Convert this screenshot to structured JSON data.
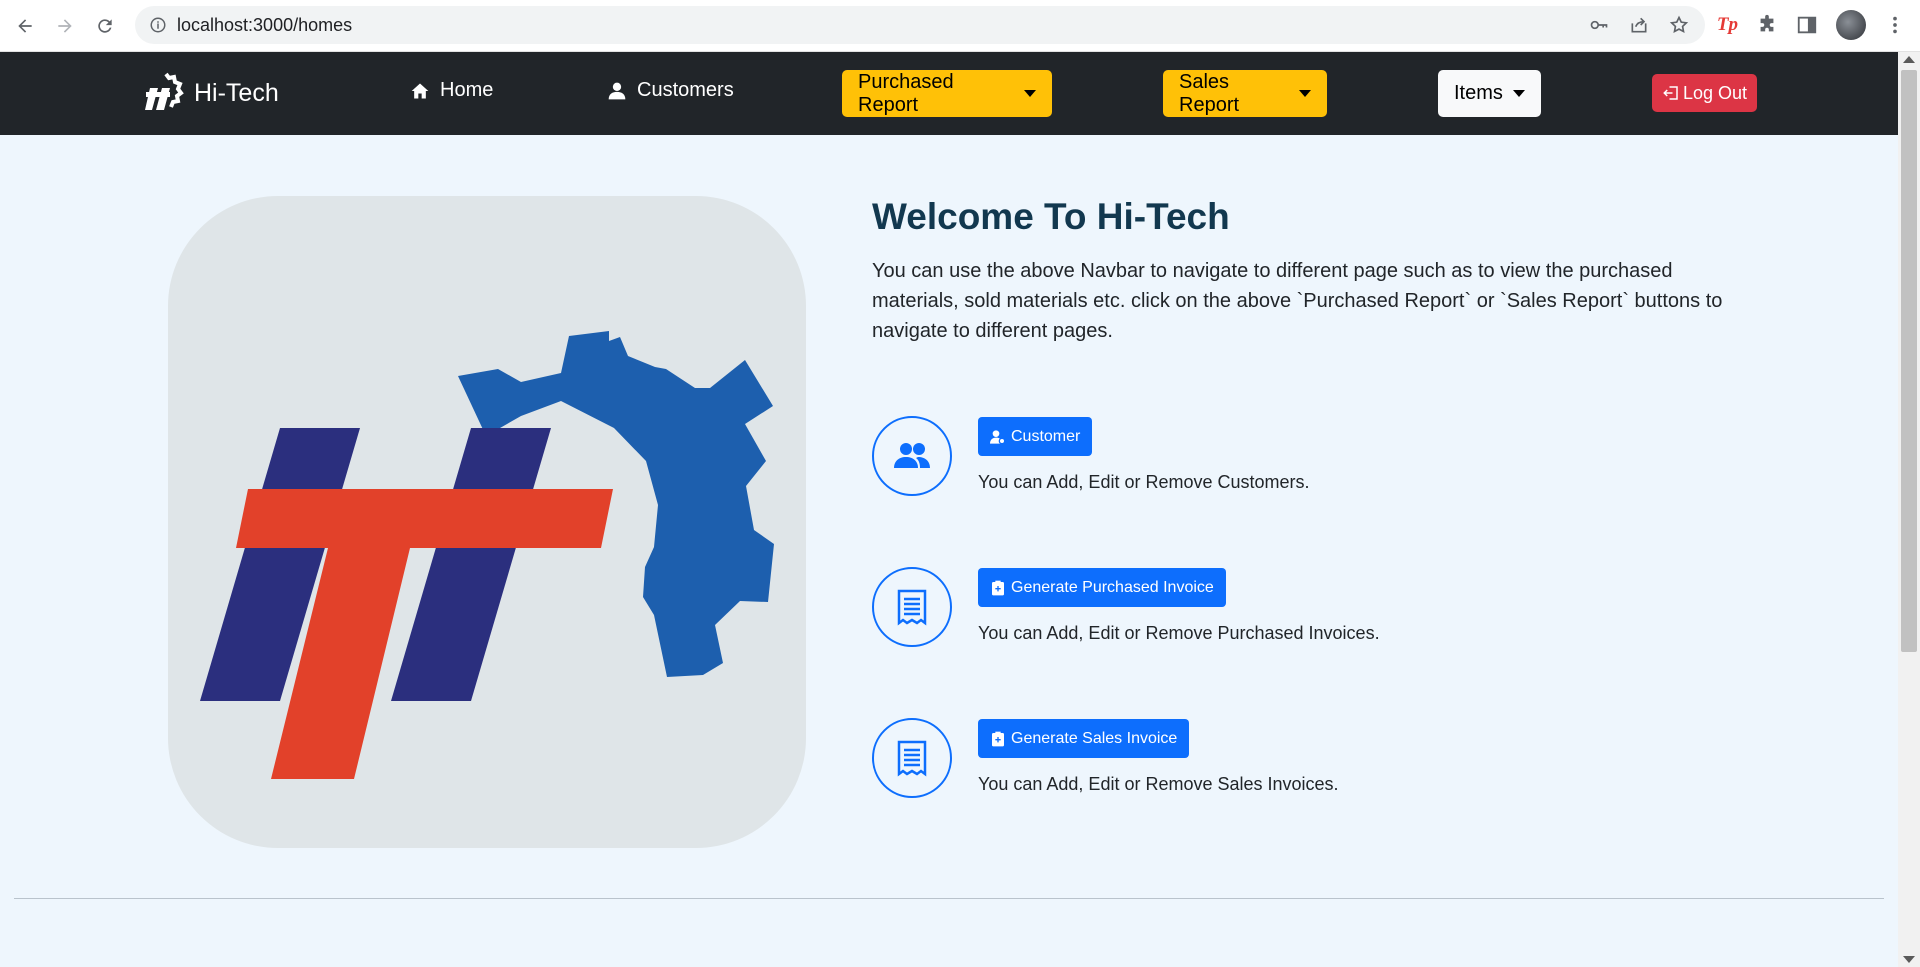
{
  "browser": {
    "url": "localhost:3000/homes"
  },
  "navbar": {
    "brand": "Hi-Tech",
    "home": "Home",
    "customers": "Customers",
    "purchased_report": "Purchased Report",
    "sales_report": "Sales Report",
    "items": "Items",
    "logout": "Log Out"
  },
  "main": {
    "title": "Welcome To Hi-Tech",
    "description": "You can use the above Navbar to navigate to different page such as to view the purchased materials, sold materials etc. click on the above `Purchased Report` or `Sales Report` buttons to navigate to different pages.",
    "features": [
      {
        "button": "Customer",
        "text": "You can Add, Edit or Remove Customers.",
        "icon": "users-icon"
      },
      {
        "button": "Generate Purchased Invoice",
        "text": "You can Add, Edit or Remove Purchased Invoices.",
        "icon": "receipt-icon"
      },
      {
        "button": "Generate Sales Invoice",
        "text": "You can Add, Edit or Remove Sales Invoices.",
        "icon": "receipt-icon"
      }
    ]
  },
  "colors": {
    "navbar": "#212529",
    "warning": "#ffc107",
    "danger": "#dc3545",
    "primary": "#0d6efd",
    "page_bg": "#eef6fd"
  }
}
